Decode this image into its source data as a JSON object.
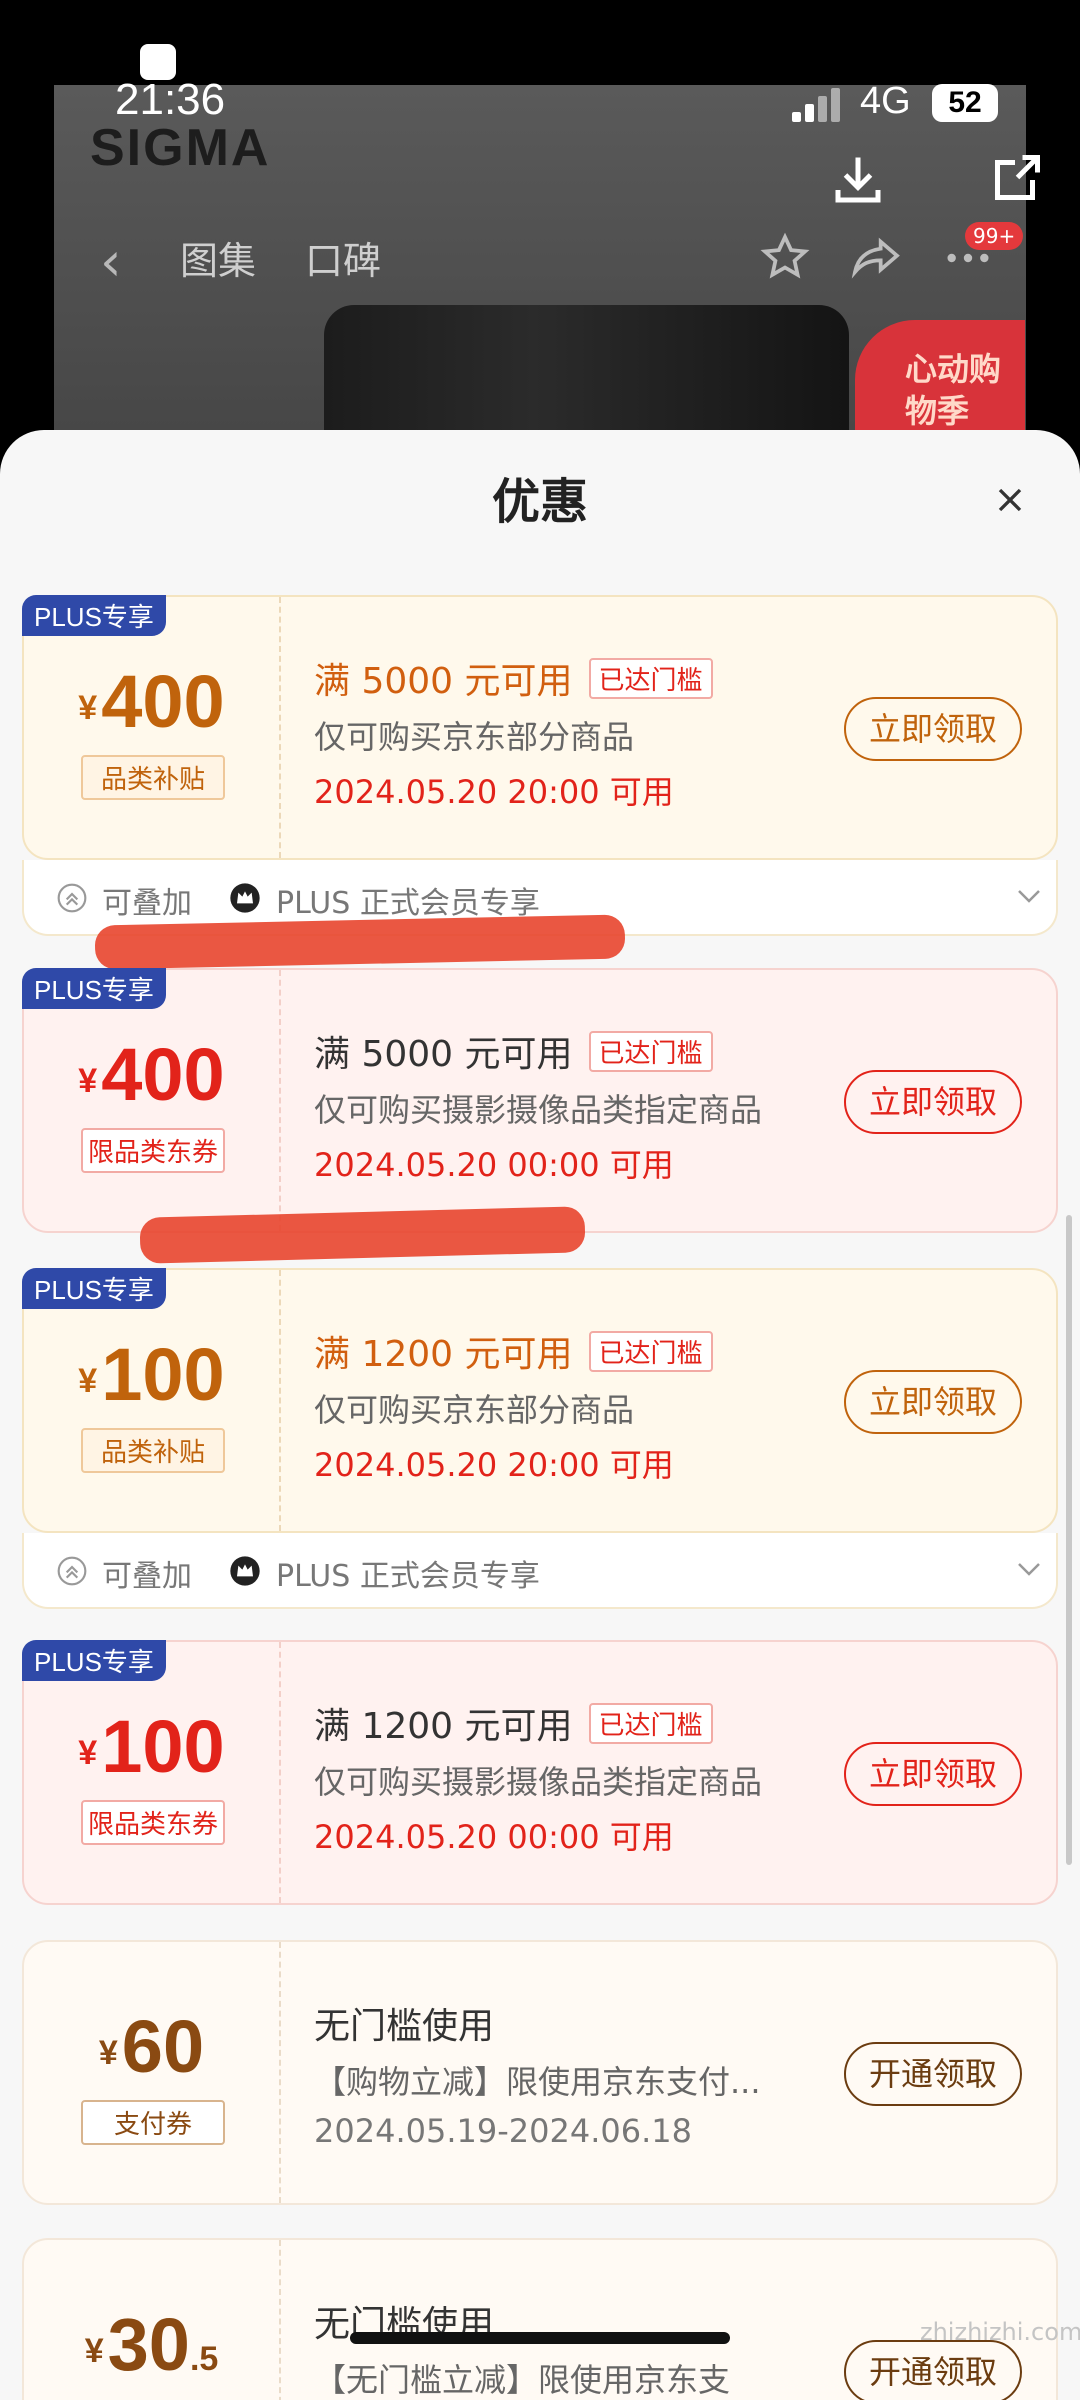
{
  "status_bar": {
    "time": "21:36",
    "network": "4G",
    "battery": "52"
  },
  "background": {
    "brand": "SIGMA",
    "promo_badge": "心动购物季"
  },
  "nav": {
    "tabs": [
      "图集",
      "口碑"
    ],
    "cart_badge": "99+"
  },
  "sheet": {
    "title": "优惠"
  },
  "coupons": [
    {
      "tag": "PLUS专享",
      "yen": "¥",
      "amount": "400",
      "category": "品类补贴",
      "condition": "满 5000 元可用",
      "reached": "已达门槛",
      "scope": "仅可购买京东部分商品",
      "date": "2024.05.20 20:00 可用",
      "button": "立即领取"
    },
    {
      "tag": "PLUS专享",
      "yen": "¥",
      "amount": "400",
      "category": "限品类东券",
      "condition": "满 5000 元可用",
      "reached": "已达门槛",
      "scope": "仅可购买摄影摄像品类指定商品",
      "date": "2024.05.20 00:00 可用",
      "button": "立即领取"
    },
    {
      "tag": "PLUS专享",
      "yen": "¥",
      "amount": "100",
      "category": "品类补贴",
      "condition": "满 1200 元可用",
      "reached": "已达门槛",
      "scope": "仅可购买京东部分商品",
      "date": "2024.05.20 20:00 可用",
      "button": "立即领取"
    },
    {
      "tag": "PLUS专享",
      "yen": "¥",
      "amount": "100",
      "category": "限品类东券",
      "condition": "满 1200 元可用",
      "reached": "已达门槛",
      "scope": "仅可购买摄影摄像品类指定商品",
      "date": "2024.05.20 00:00 可用",
      "button": "立即领取"
    },
    {
      "yen": "¥",
      "amount": "60",
      "category": "支付券",
      "condition": "无门槛使用",
      "scope": "【购物立减】限使用京东支付...",
      "date": "2024.05.19-2024.06.18",
      "button": "开通领取"
    },
    {
      "yen": "¥",
      "amount": "30",
      "decimal": ".5",
      "condition": "无门槛使用",
      "scope": "【无门槛立减】限使用京东支",
      "button": "开通领取"
    }
  ],
  "footer": {
    "stackable": "可叠加",
    "plus_only": "PLUS 正式会员专享"
  },
  "watermark": "zhizhizhi.com",
  "colors": {
    "accent_red": "#e2231a",
    "gold": "#c0630c",
    "plus_blue": "#2f49a8"
  }
}
